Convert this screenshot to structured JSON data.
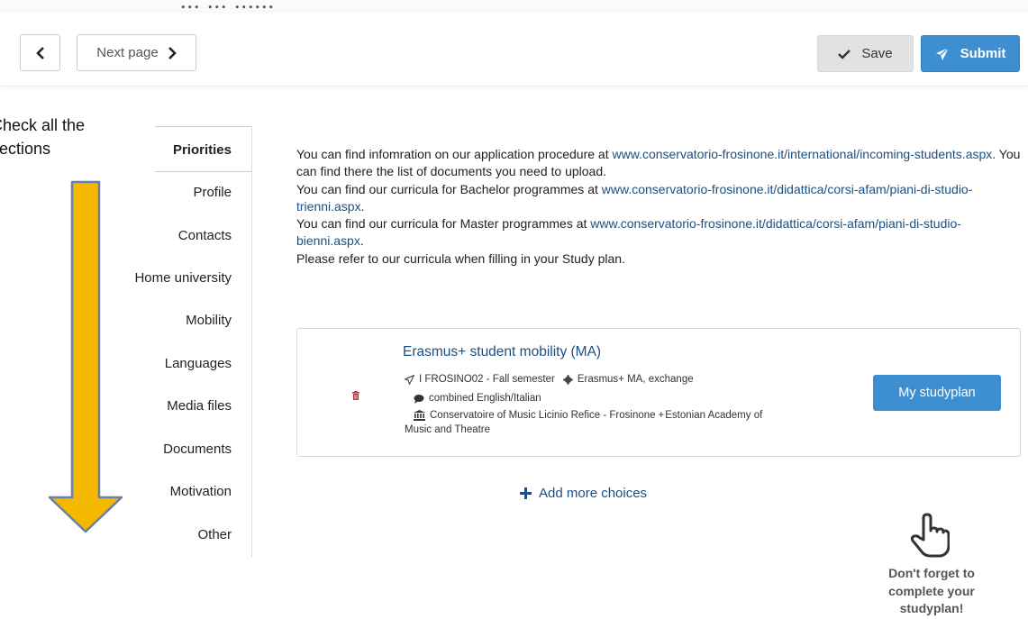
{
  "header": {
    "cut_title": "... ... ......"
  },
  "toolbar": {
    "next_label": "Next page",
    "save_label": "Save",
    "submit_label": "Submit"
  },
  "annotation": {
    "line1": "Check all the",
    "line2": "sections"
  },
  "sidebar": {
    "items": [
      {
        "label": "Priorities"
      },
      {
        "label": "Profile"
      },
      {
        "label": "Contacts"
      },
      {
        "label": "Home university"
      },
      {
        "label": "Mobility"
      },
      {
        "label": "Languages"
      },
      {
        "label": "Media files"
      },
      {
        "label": "Documents"
      },
      {
        "label": "Motivation"
      },
      {
        "label": "Other"
      }
    ]
  },
  "info": {
    "p1_text": "You can find infomration on our application procedure at ",
    "p1_link": "www.conservatorio-frosinone.it/international/incoming-students.aspx",
    "p1_tail": ". You can find there the list of documents you need to upload.",
    "p2_text": "You can find our curricula for Bachelor programmes at ",
    "p2_link": "www.conservatorio-frosinone.it/didattica/corsi-afam/piani-di-studio-trienni.aspx",
    "p2_tail": ".",
    "p3_text": "You can find our curricula for Master programmes at ",
    "p3_link": "www.conservatorio-frosinone.it/didattica/corsi-afam/piani-di-studio-bienni.aspx",
    "p3_tail": ".",
    "p4_text": "Please refer to our curricula when filling in your Study plan."
  },
  "choice": {
    "title": "Erasmus+ student mobility (MA)",
    "code_semester": "I FROSINO02 - Fall semester",
    "program": "Erasmus+ MA, exchange",
    "language": "combined English/Italian",
    "institutions_line1": "Conservatoire of Music Licinio Refice - Frosinone",
    "institutions_line1_tail": " Estonian Academy of",
    "institutions_line2": "Music and Theatre",
    "study_button": "My studyplan"
  },
  "add_more_label": "Add more choices",
  "reminder": {
    "line1": "Don't forget to",
    "line2": "complete your",
    "line3": "studyplan!"
  },
  "colors": {
    "accent": "#3d8fd1",
    "link": "#1c4f82",
    "arrow_fill": "#f5b800",
    "arrow_stroke": "#6a7fa8",
    "trash": "#c9252c"
  },
  "icons": {
    "prev": "chevron-left-icon",
    "next": "chevron-right-icon",
    "save": "check-icon",
    "submit": "paper-plane-icon",
    "trash": "trash-icon",
    "program": "asterisk-icon",
    "language": "speech-bubble-icon",
    "institution": "bank-icon",
    "add": "plus-icon",
    "reminder": "pointing-hand-icon"
  }
}
